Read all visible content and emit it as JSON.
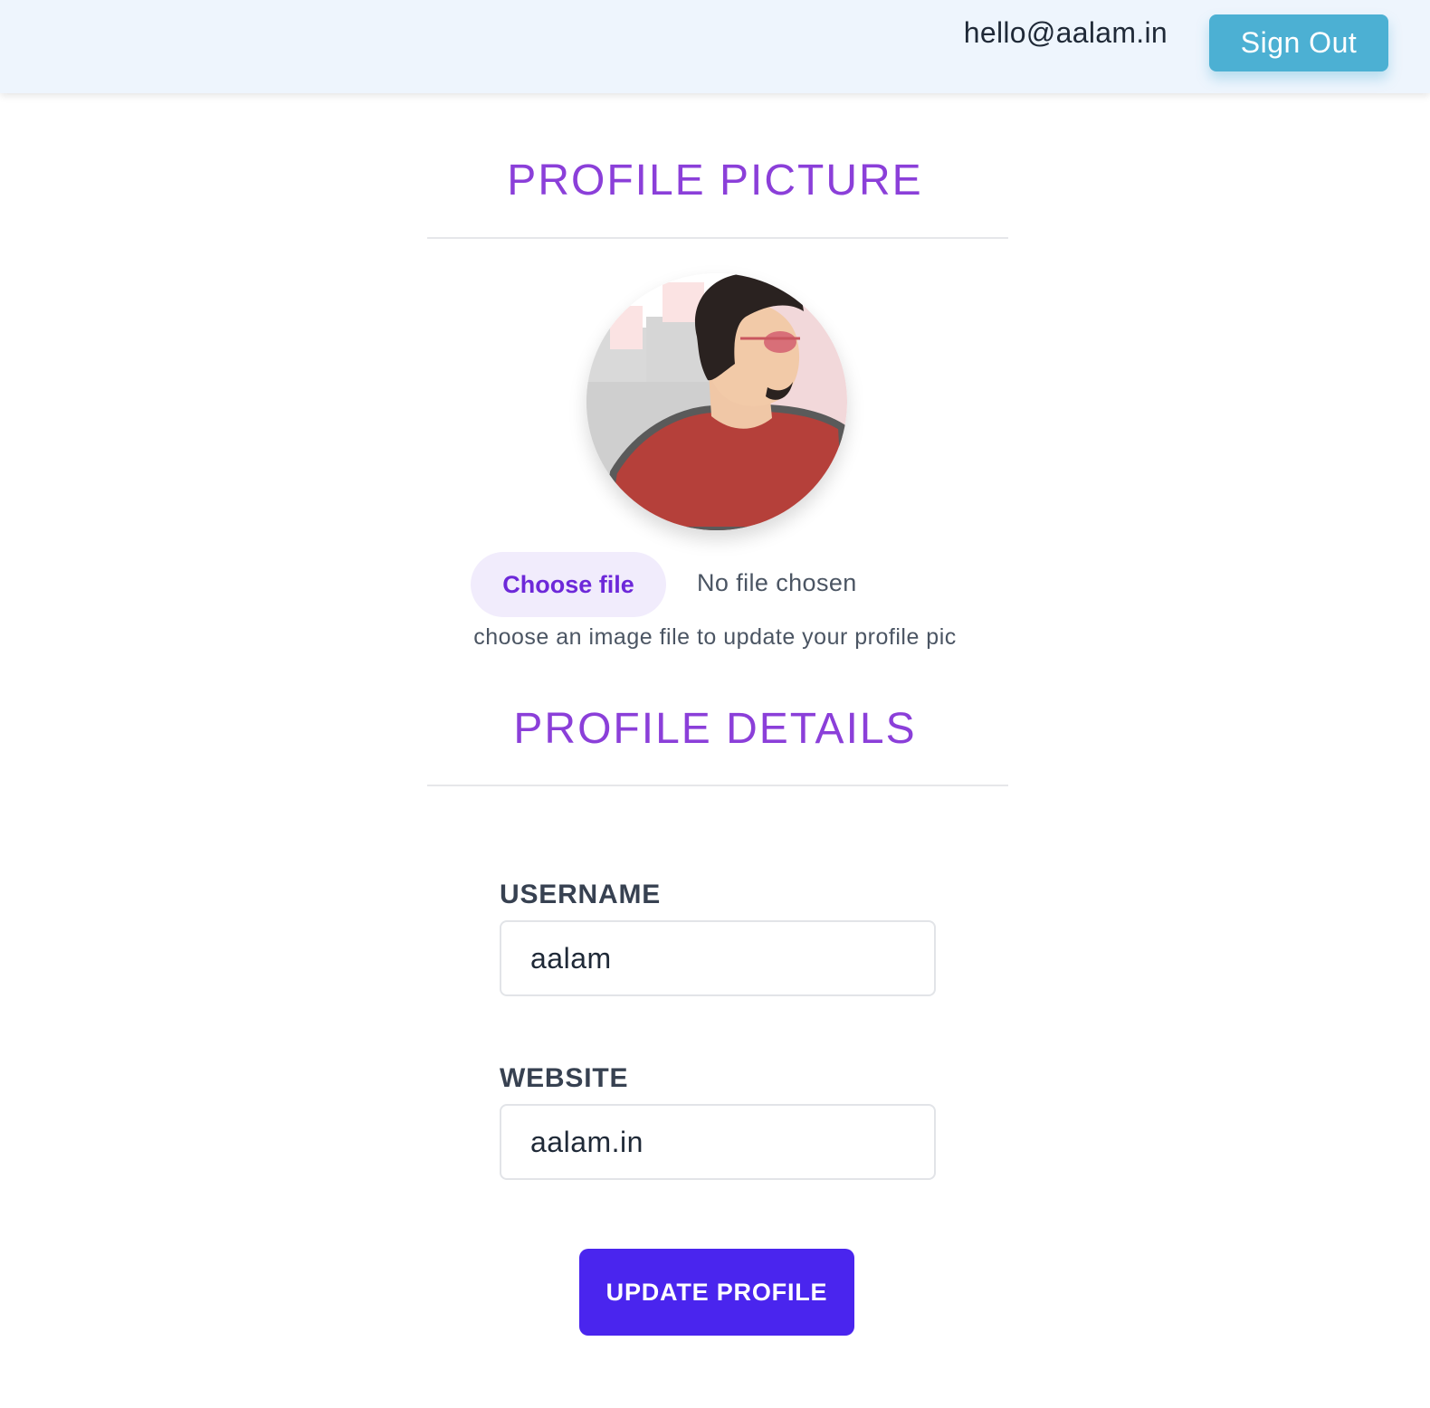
{
  "header": {
    "user_email": "hello@aalam.in",
    "sign_out_label": "Sign Out"
  },
  "profile_picture": {
    "title": "PROFILE PICTURE",
    "choose_file_label": "Choose file",
    "file_status": "No file chosen",
    "helper_text": "choose an image file to update your profile pic"
  },
  "profile_details": {
    "title": "PROFILE DETAILS",
    "username_label": "USERNAME",
    "username_value": "aalam",
    "website_label": "WEBSITE",
    "website_value": "aalam.in",
    "update_button_label": "UPDATE PROFILE"
  },
  "colors": {
    "header_bg": "#eef5fd",
    "sign_out_bg": "#4cb0d3",
    "section_title": "#8b3fd9",
    "choose_file_bg": "#f1ecfc",
    "choose_file_text": "#6d28d9",
    "update_button_bg": "#4a25ee"
  }
}
